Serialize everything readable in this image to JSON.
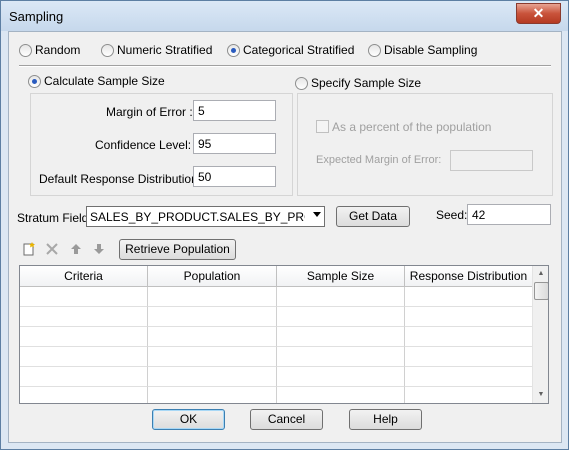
{
  "window": {
    "title": "Sampling",
    "close_glyph": "✕"
  },
  "modes": [
    {
      "label": "Random",
      "checked": false
    },
    {
      "label": "Numeric Stratified",
      "checked": false
    },
    {
      "label": "Categorical Stratified",
      "checked": true
    },
    {
      "label": "Disable Sampling",
      "checked": false
    }
  ],
  "calc": {
    "label": "Calculate Sample Size",
    "checked": true,
    "margin_label": "Margin of Error :",
    "margin_value": "5",
    "confidence_label": "Confidence Level:",
    "confidence_value": "95",
    "distribution_label": "Default Response Distribution:",
    "distribution_value": "50"
  },
  "specify": {
    "label": "Specify Sample Size",
    "checked": false,
    "percent_label": "As a percent of the population",
    "expected_label": "Expected Margin of Error:",
    "expected_value": ""
  },
  "stratum": {
    "label": "Stratum Field:",
    "value": "SALES_BY_PRODUCT.SALES_BY_PRODUCT",
    "get_data_label": "Get Data",
    "seed_label": "Seed:",
    "seed_value": "42"
  },
  "toolbar": {
    "new_icon": "new-row-icon",
    "delete_icon": "delete-icon",
    "up_icon": "arrow-up-icon",
    "down_icon": "arrow-down-icon",
    "retrieve_label": "Retrieve Population"
  },
  "grid": {
    "columns": [
      "Criteria",
      "Population",
      "Sample Size",
      "Response Distribution"
    ]
  },
  "footer": {
    "ok_label": "OK",
    "cancel_label": "Cancel",
    "help_label": "Help"
  }
}
